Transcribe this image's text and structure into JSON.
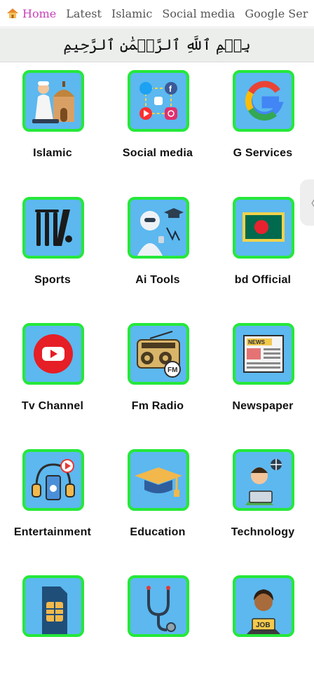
{
  "tabs": [
    {
      "label": "Home",
      "active": true,
      "icon": "house-icon"
    },
    {
      "label": "Latest"
    },
    {
      "label": "Islamic"
    },
    {
      "label": "Social media"
    },
    {
      "label": "Google Ser"
    }
  ],
  "banner": {
    "text": "بِسۡمِ ٱللَّهِ ٱلرَّحۡمَٰنِ ٱلرَّحِيمِ"
  },
  "grid": {
    "items": [
      {
        "label": "Islamic",
        "icon": "praying-man-mosque-icon"
      },
      {
        "label": "Social media",
        "icon": "social-media-apps-icon"
      },
      {
        "label": "G Services",
        "icon": "google-g-icon"
      },
      {
        "label": "Sports",
        "icon": "cricket-stumps-icon"
      },
      {
        "label": "Ai Tools",
        "icon": "robot-graduate-icon"
      },
      {
        "label": "bd Official",
        "icon": "bangladesh-flag-icon"
      },
      {
        "label": "Tv Channel",
        "icon": "youtube-play-icon"
      },
      {
        "label": "Fm Radio",
        "icon": "radio-icon"
      },
      {
        "label": "Newspaper",
        "icon": "newspaper-icon"
      },
      {
        "label": "Entertainment",
        "icon": "headphones-phone-icon"
      },
      {
        "label": "Education",
        "icon": "graduation-cap-icon"
      },
      {
        "label": "Technology",
        "icon": "person-laptop-icon"
      },
      {
        "label": "",
        "icon": "sim-card-icon"
      },
      {
        "label": "",
        "icon": "stethoscope-icon"
      },
      {
        "label": "",
        "icon": "job-person-icon"
      }
    ]
  },
  "side_handle": {
    "glyph": "〈"
  },
  "colors": {
    "tile_bg": "#5cb8ef",
    "tile_border": "#25e83a",
    "active_tab": "#c93fb8"
  }
}
